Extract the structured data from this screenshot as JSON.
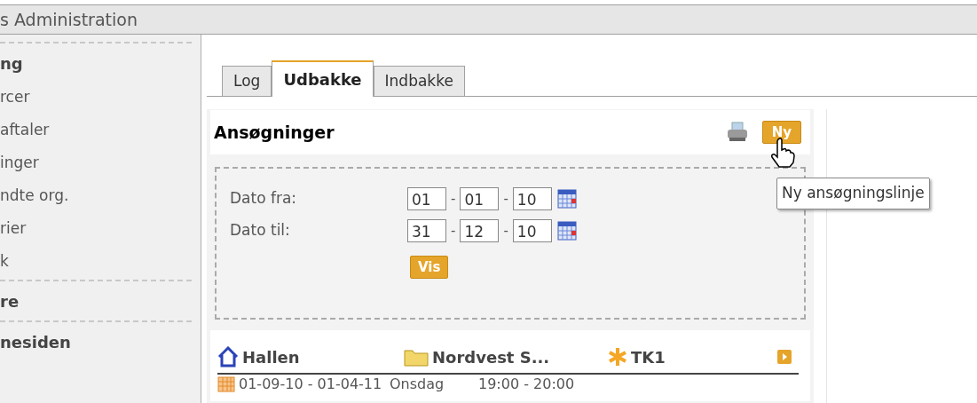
{
  "window": {
    "title": "s Administration"
  },
  "sidebar": {
    "sections": [
      {
        "label": "ng",
        "items": [
          "rcer",
          "aftaler",
          "inger",
          "ndte org.",
          "rier",
          "k"
        ]
      },
      {
        "label": "re"
      },
      {
        "label": "nesiden"
      }
    ]
  },
  "tabs": [
    {
      "label": "Log",
      "selected": false
    },
    {
      "label": "Udbakke",
      "selected": true
    },
    {
      "label": "Indbakke",
      "selected": false
    }
  ],
  "panel": {
    "title": "Ansøgninger",
    "new_button": "Ny",
    "tooltip": "Ny ansøgningslinje",
    "filter": {
      "rows": [
        {
          "label": "Dato fra:",
          "fields": [
            "01",
            "01",
            "10"
          ],
          "separators": [
            "-",
            "-"
          ]
        },
        {
          "label": "Dato til:",
          "fields": [
            "31",
            "12",
            "10"
          ],
          "separators": [
            "-",
            "-"
          ]
        }
      ],
      "show_button": "Vis"
    },
    "result": {
      "header": [
        {
          "kind": "house",
          "text": "Hallen"
        },
        {
          "kind": "folder",
          "text": "Nordvest S..."
        },
        {
          "kind": "asterisk",
          "text": "TK1"
        }
      ],
      "row": {
        "dates": "01-09-10 - 01-04-11",
        "day": "Onsdag",
        "time": "19:00 - 20:00"
      }
    }
  }
}
